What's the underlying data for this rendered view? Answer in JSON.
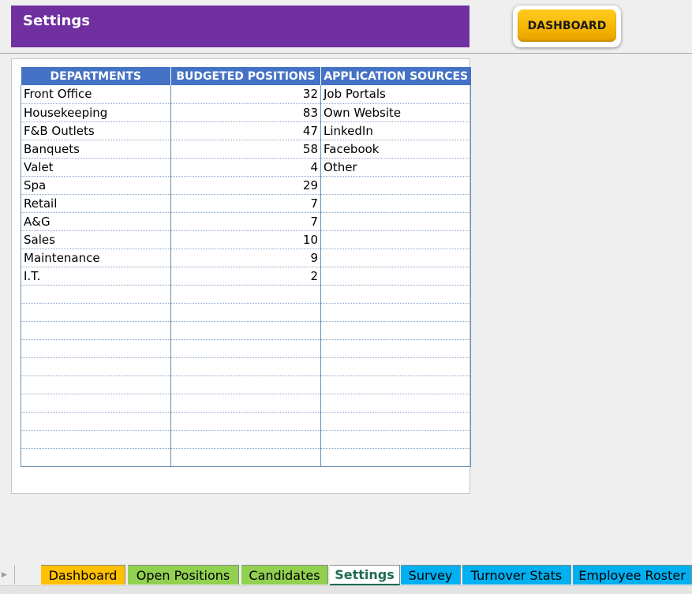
{
  "header": {
    "title": "Settings",
    "dashboard_button": "DASHBOARD",
    "colors": {
      "title_bg": "#7030a0",
      "button": "#f5b400"
    }
  },
  "table": {
    "headers": [
      "DEPARTMENTS",
      "BUDGETED POSITIONS",
      "APPLICATION SOURCES"
    ],
    "rows": [
      [
        "Front Office",
        "32",
        "Job Portals"
      ],
      [
        "Housekeeping",
        "83",
        "Own Website"
      ],
      [
        "F&B Outlets",
        "47",
        "LinkedIn"
      ],
      [
        "Banquets",
        "58",
        "Facebook"
      ],
      [
        "Valet",
        "4",
        "Other"
      ],
      [
        "Spa",
        "29",
        ""
      ],
      [
        "Retail",
        "7",
        ""
      ],
      [
        "A&G",
        "7",
        ""
      ],
      [
        "Sales",
        "10",
        ""
      ],
      [
        "Maintenance",
        "9",
        ""
      ],
      [
        "I.T.",
        "2",
        ""
      ],
      [
        "",
        "",
        ""
      ],
      [
        "",
        "",
        ""
      ],
      [
        "",
        "",
        ""
      ],
      [
        "",
        "",
        ""
      ],
      [
        "",
        "",
        ""
      ],
      [
        "",
        "",
        ""
      ],
      [
        "",
        "",
        ""
      ],
      [
        "",
        "",
        ""
      ],
      [
        "",
        "",
        ""
      ],
      [
        "",
        "",
        ""
      ]
    ],
    "header_color": "#4472c4"
  },
  "tabs": [
    {
      "label": "Dashboard",
      "color": "#ffc000",
      "active": false
    },
    {
      "label": "Open Positions",
      "color": "#92d050",
      "active": false
    },
    {
      "label": "Candidates",
      "color": "#92d050",
      "active": false
    },
    {
      "label": "Settings",
      "color": "#ffffff",
      "active": true
    },
    {
      "label": "Survey",
      "color": "#00b0f0",
      "active": false
    },
    {
      "label": "Turnover Stats",
      "color": "#00b0f0",
      "active": false
    },
    {
      "label": "Employee Roster",
      "color": "#00b0f0",
      "active": false
    }
  ],
  "icons": {
    "tab_scroll": "triangle-right-icon"
  }
}
